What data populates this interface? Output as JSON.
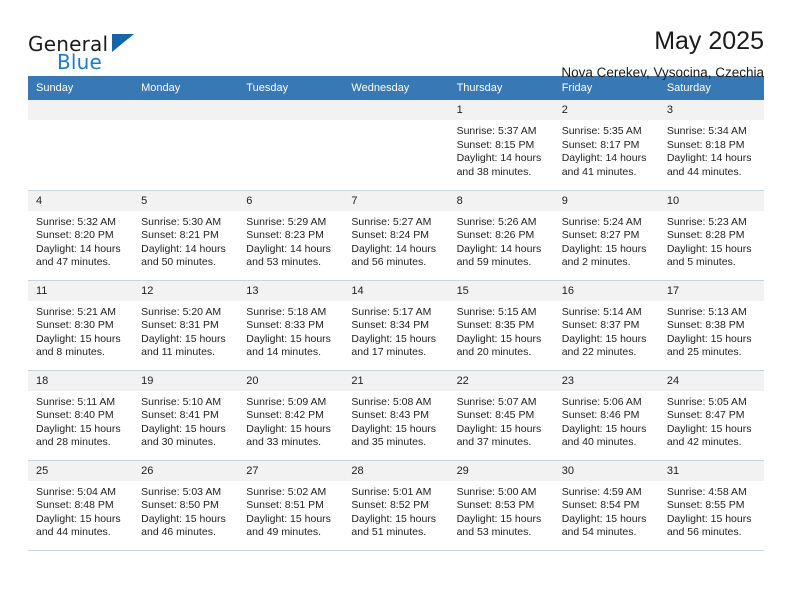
{
  "brand": {
    "name_top": "General",
    "name_bottom": "Blue",
    "triangle_color": "#1565a8",
    "blue_text_color": "#1d7dc4"
  },
  "header": {
    "title": "May 2025",
    "subtitle": "Nova Cerekev, Vysocina, Czechia"
  },
  "theme": {
    "header_row_bg": "#3878b4",
    "header_row_text": "#ffffff",
    "daynum_bg": "#f2f2f2",
    "grid_line": "#c8d4e0",
    "body_text": "#222222"
  },
  "weekday_headers": [
    "Sunday",
    "Monday",
    "Tuesday",
    "Wednesday",
    "Thursday",
    "Friday",
    "Saturday"
  ],
  "labels": {
    "sunrise_prefix": "Sunrise:",
    "sunset_prefix": "Sunset:",
    "daylight_prefix": "Daylight:"
  },
  "weeks": [
    [
      {
        "day": "",
        "sunrise": "",
        "sunset": "",
        "daylight": "",
        "empty": true
      },
      {
        "day": "",
        "sunrise": "",
        "sunset": "",
        "daylight": "",
        "empty": true
      },
      {
        "day": "",
        "sunrise": "",
        "sunset": "",
        "daylight": "",
        "empty": true
      },
      {
        "day": "",
        "sunrise": "",
        "sunset": "",
        "daylight": "",
        "empty": true
      },
      {
        "day": "1",
        "sunrise": "Sunrise: 5:37 AM",
        "sunset": "Sunset: 8:15 PM",
        "daylight": "Daylight: 14 hours and 38 minutes.",
        "empty": false
      },
      {
        "day": "2",
        "sunrise": "Sunrise: 5:35 AM",
        "sunset": "Sunset: 8:17 PM",
        "daylight": "Daylight: 14 hours and 41 minutes.",
        "empty": false
      },
      {
        "day": "3",
        "sunrise": "Sunrise: 5:34 AM",
        "sunset": "Sunset: 8:18 PM",
        "daylight": "Daylight: 14 hours and 44 minutes.",
        "empty": false
      }
    ],
    [
      {
        "day": "4",
        "sunrise": "Sunrise: 5:32 AM",
        "sunset": "Sunset: 8:20 PM",
        "daylight": "Daylight: 14 hours and 47 minutes.",
        "empty": false
      },
      {
        "day": "5",
        "sunrise": "Sunrise: 5:30 AM",
        "sunset": "Sunset: 8:21 PM",
        "daylight": "Daylight: 14 hours and 50 minutes.",
        "empty": false
      },
      {
        "day": "6",
        "sunrise": "Sunrise: 5:29 AM",
        "sunset": "Sunset: 8:23 PM",
        "daylight": "Daylight: 14 hours and 53 minutes.",
        "empty": false
      },
      {
        "day": "7",
        "sunrise": "Sunrise: 5:27 AM",
        "sunset": "Sunset: 8:24 PM",
        "daylight": "Daylight: 14 hours and 56 minutes.",
        "empty": false
      },
      {
        "day": "8",
        "sunrise": "Sunrise: 5:26 AM",
        "sunset": "Sunset: 8:26 PM",
        "daylight": "Daylight: 14 hours and 59 minutes.",
        "empty": false
      },
      {
        "day": "9",
        "sunrise": "Sunrise: 5:24 AM",
        "sunset": "Sunset: 8:27 PM",
        "daylight": "Daylight: 15 hours and 2 minutes.",
        "empty": false
      },
      {
        "day": "10",
        "sunrise": "Sunrise: 5:23 AM",
        "sunset": "Sunset: 8:28 PM",
        "daylight": "Daylight: 15 hours and 5 minutes.",
        "empty": false
      }
    ],
    [
      {
        "day": "11",
        "sunrise": "Sunrise: 5:21 AM",
        "sunset": "Sunset: 8:30 PM",
        "daylight": "Daylight: 15 hours and 8 minutes.",
        "empty": false
      },
      {
        "day": "12",
        "sunrise": "Sunrise: 5:20 AM",
        "sunset": "Sunset: 8:31 PM",
        "daylight": "Daylight: 15 hours and 11 minutes.",
        "empty": false
      },
      {
        "day": "13",
        "sunrise": "Sunrise: 5:18 AM",
        "sunset": "Sunset: 8:33 PM",
        "daylight": "Daylight: 15 hours and 14 minutes.",
        "empty": false
      },
      {
        "day": "14",
        "sunrise": "Sunrise: 5:17 AM",
        "sunset": "Sunset: 8:34 PM",
        "daylight": "Daylight: 15 hours and 17 minutes.",
        "empty": false
      },
      {
        "day": "15",
        "sunrise": "Sunrise: 5:15 AM",
        "sunset": "Sunset: 8:35 PM",
        "daylight": "Daylight: 15 hours and 20 minutes.",
        "empty": false
      },
      {
        "day": "16",
        "sunrise": "Sunrise: 5:14 AM",
        "sunset": "Sunset: 8:37 PM",
        "daylight": "Daylight: 15 hours and 22 minutes.",
        "empty": false
      },
      {
        "day": "17",
        "sunrise": "Sunrise: 5:13 AM",
        "sunset": "Sunset: 8:38 PM",
        "daylight": "Daylight: 15 hours and 25 minutes.",
        "empty": false
      }
    ],
    [
      {
        "day": "18",
        "sunrise": "Sunrise: 5:11 AM",
        "sunset": "Sunset: 8:40 PM",
        "daylight": "Daylight: 15 hours and 28 minutes.",
        "empty": false
      },
      {
        "day": "19",
        "sunrise": "Sunrise: 5:10 AM",
        "sunset": "Sunset: 8:41 PM",
        "daylight": "Daylight: 15 hours and 30 minutes.",
        "empty": false
      },
      {
        "day": "20",
        "sunrise": "Sunrise: 5:09 AM",
        "sunset": "Sunset: 8:42 PM",
        "daylight": "Daylight: 15 hours and 33 minutes.",
        "empty": false
      },
      {
        "day": "21",
        "sunrise": "Sunrise: 5:08 AM",
        "sunset": "Sunset: 8:43 PM",
        "daylight": "Daylight: 15 hours and 35 minutes.",
        "empty": false
      },
      {
        "day": "22",
        "sunrise": "Sunrise: 5:07 AM",
        "sunset": "Sunset: 8:45 PM",
        "daylight": "Daylight: 15 hours and 37 minutes.",
        "empty": false
      },
      {
        "day": "23",
        "sunrise": "Sunrise: 5:06 AM",
        "sunset": "Sunset: 8:46 PM",
        "daylight": "Daylight: 15 hours and 40 minutes.",
        "empty": false
      },
      {
        "day": "24",
        "sunrise": "Sunrise: 5:05 AM",
        "sunset": "Sunset: 8:47 PM",
        "daylight": "Daylight: 15 hours and 42 minutes.",
        "empty": false
      }
    ],
    [
      {
        "day": "25",
        "sunrise": "Sunrise: 5:04 AM",
        "sunset": "Sunset: 8:48 PM",
        "daylight": "Daylight: 15 hours and 44 minutes.",
        "empty": false
      },
      {
        "day": "26",
        "sunrise": "Sunrise: 5:03 AM",
        "sunset": "Sunset: 8:50 PM",
        "daylight": "Daylight: 15 hours and 46 minutes.",
        "empty": false
      },
      {
        "day": "27",
        "sunrise": "Sunrise: 5:02 AM",
        "sunset": "Sunset: 8:51 PM",
        "daylight": "Daylight: 15 hours and 49 minutes.",
        "empty": false
      },
      {
        "day": "28",
        "sunrise": "Sunrise: 5:01 AM",
        "sunset": "Sunset: 8:52 PM",
        "daylight": "Daylight: 15 hours and 51 minutes.",
        "empty": false
      },
      {
        "day": "29",
        "sunrise": "Sunrise: 5:00 AM",
        "sunset": "Sunset: 8:53 PM",
        "daylight": "Daylight: 15 hours and 53 minutes.",
        "empty": false
      },
      {
        "day": "30",
        "sunrise": "Sunrise: 4:59 AM",
        "sunset": "Sunset: 8:54 PM",
        "daylight": "Daylight: 15 hours and 54 minutes.",
        "empty": false
      },
      {
        "day": "31",
        "sunrise": "Sunrise: 4:58 AM",
        "sunset": "Sunset: 8:55 PM",
        "daylight": "Daylight: 15 hours and 56 minutes.",
        "empty": false
      }
    ]
  ]
}
